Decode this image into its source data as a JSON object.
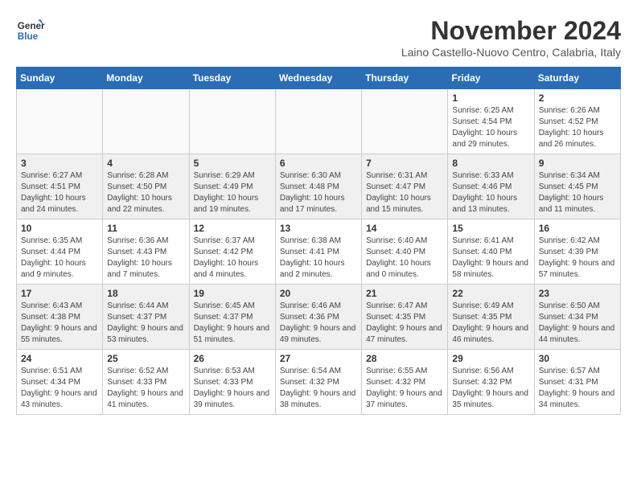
{
  "logo": {
    "line1": "General",
    "line2": "Blue"
  },
  "title": "November 2024",
  "subtitle": "Laino Castello-Nuovo Centro, Calabria, Italy",
  "weekdays": [
    "Sunday",
    "Monday",
    "Tuesday",
    "Wednesday",
    "Thursday",
    "Friday",
    "Saturday"
  ],
  "weeks": [
    [
      {
        "day": "",
        "info": ""
      },
      {
        "day": "",
        "info": ""
      },
      {
        "day": "",
        "info": ""
      },
      {
        "day": "",
        "info": ""
      },
      {
        "day": "",
        "info": ""
      },
      {
        "day": "1",
        "info": "Sunrise: 6:25 AM\nSunset: 4:54 PM\nDaylight: 10 hours and 29 minutes."
      },
      {
        "day": "2",
        "info": "Sunrise: 6:26 AM\nSunset: 4:52 PM\nDaylight: 10 hours and 26 minutes."
      }
    ],
    [
      {
        "day": "3",
        "info": "Sunrise: 6:27 AM\nSunset: 4:51 PM\nDaylight: 10 hours and 24 minutes."
      },
      {
        "day": "4",
        "info": "Sunrise: 6:28 AM\nSunset: 4:50 PM\nDaylight: 10 hours and 22 minutes."
      },
      {
        "day": "5",
        "info": "Sunrise: 6:29 AM\nSunset: 4:49 PM\nDaylight: 10 hours and 19 minutes."
      },
      {
        "day": "6",
        "info": "Sunrise: 6:30 AM\nSunset: 4:48 PM\nDaylight: 10 hours and 17 minutes."
      },
      {
        "day": "7",
        "info": "Sunrise: 6:31 AM\nSunset: 4:47 PM\nDaylight: 10 hours and 15 minutes."
      },
      {
        "day": "8",
        "info": "Sunrise: 6:33 AM\nSunset: 4:46 PM\nDaylight: 10 hours and 13 minutes."
      },
      {
        "day": "9",
        "info": "Sunrise: 6:34 AM\nSunset: 4:45 PM\nDaylight: 10 hours and 11 minutes."
      }
    ],
    [
      {
        "day": "10",
        "info": "Sunrise: 6:35 AM\nSunset: 4:44 PM\nDaylight: 10 hours and 9 minutes."
      },
      {
        "day": "11",
        "info": "Sunrise: 6:36 AM\nSunset: 4:43 PM\nDaylight: 10 hours and 7 minutes."
      },
      {
        "day": "12",
        "info": "Sunrise: 6:37 AM\nSunset: 4:42 PM\nDaylight: 10 hours and 4 minutes."
      },
      {
        "day": "13",
        "info": "Sunrise: 6:38 AM\nSunset: 4:41 PM\nDaylight: 10 hours and 2 minutes."
      },
      {
        "day": "14",
        "info": "Sunrise: 6:40 AM\nSunset: 4:40 PM\nDaylight: 10 hours and 0 minutes."
      },
      {
        "day": "15",
        "info": "Sunrise: 6:41 AM\nSunset: 4:40 PM\nDaylight: 9 hours and 58 minutes."
      },
      {
        "day": "16",
        "info": "Sunrise: 6:42 AM\nSunset: 4:39 PM\nDaylight: 9 hours and 57 minutes."
      }
    ],
    [
      {
        "day": "17",
        "info": "Sunrise: 6:43 AM\nSunset: 4:38 PM\nDaylight: 9 hours and 55 minutes."
      },
      {
        "day": "18",
        "info": "Sunrise: 6:44 AM\nSunset: 4:37 PM\nDaylight: 9 hours and 53 minutes."
      },
      {
        "day": "19",
        "info": "Sunrise: 6:45 AM\nSunset: 4:37 PM\nDaylight: 9 hours and 51 minutes."
      },
      {
        "day": "20",
        "info": "Sunrise: 6:46 AM\nSunset: 4:36 PM\nDaylight: 9 hours and 49 minutes."
      },
      {
        "day": "21",
        "info": "Sunrise: 6:47 AM\nSunset: 4:35 PM\nDaylight: 9 hours and 47 minutes."
      },
      {
        "day": "22",
        "info": "Sunrise: 6:49 AM\nSunset: 4:35 PM\nDaylight: 9 hours and 46 minutes."
      },
      {
        "day": "23",
        "info": "Sunrise: 6:50 AM\nSunset: 4:34 PM\nDaylight: 9 hours and 44 minutes."
      }
    ],
    [
      {
        "day": "24",
        "info": "Sunrise: 6:51 AM\nSunset: 4:34 PM\nDaylight: 9 hours and 43 minutes."
      },
      {
        "day": "25",
        "info": "Sunrise: 6:52 AM\nSunset: 4:33 PM\nDaylight: 9 hours and 41 minutes."
      },
      {
        "day": "26",
        "info": "Sunrise: 6:53 AM\nSunset: 4:33 PM\nDaylight: 9 hours and 39 minutes."
      },
      {
        "day": "27",
        "info": "Sunrise: 6:54 AM\nSunset: 4:32 PM\nDaylight: 9 hours and 38 minutes."
      },
      {
        "day": "28",
        "info": "Sunrise: 6:55 AM\nSunset: 4:32 PM\nDaylight: 9 hours and 37 minutes."
      },
      {
        "day": "29",
        "info": "Sunrise: 6:56 AM\nSunset: 4:32 PM\nDaylight: 9 hours and 35 minutes."
      },
      {
        "day": "30",
        "info": "Sunrise: 6:57 AM\nSunset: 4:31 PM\nDaylight: 9 hours and 34 minutes."
      }
    ]
  ]
}
